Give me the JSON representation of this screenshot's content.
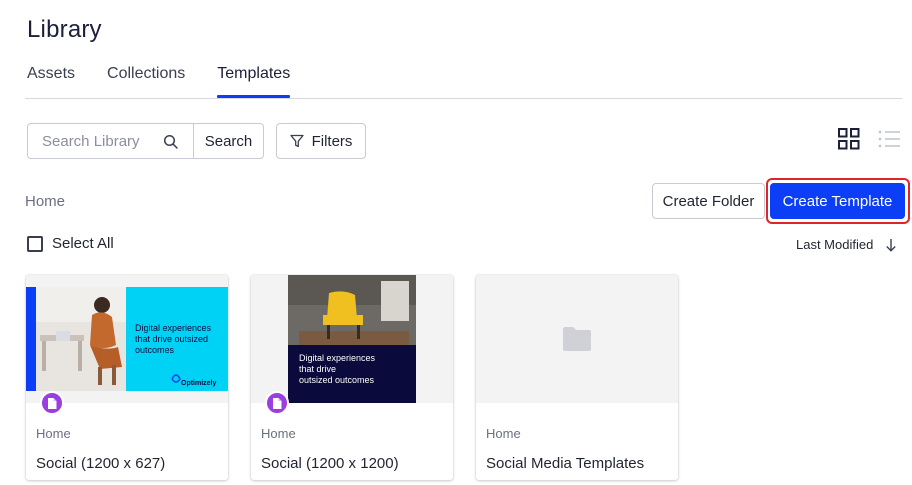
{
  "page": {
    "title": "Library"
  },
  "tabs": [
    {
      "label": "Assets"
    },
    {
      "label": "Collections"
    },
    {
      "label": "Templates",
      "active": true
    }
  ],
  "toolbar": {
    "search_placeholder": "Search Library",
    "search_value": "",
    "search_label": "Search",
    "filters_label": "Filters",
    "view_mode": "grid"
  },
  "breadcrumb": {
    "current": "Home"
  },
  "actions": {
    "create_folder_label": "Create Folder",
    "create_template_label": "Create Template"
  },
  "select_all": {
    "label": "Select All",
    "checked": false
  },
  "sort": {
    "label": "Last Modified",
    "direction": "descending"
  },
  "cards": [
    {
      "type": "template",
      "thumb_text": "Digital experiences\nthat drive outsized\noutcomes",
      "brand_text": "Optimizely",
      "folder": "Home",
      "name": "Social (1200 x 627)"
    },
    {
      "type": "template",
      "thumb_text": "Digital experiences\nthat drive\noutsized outcomes",
      "folder": "Home",
      "name": "Social (1200 x 1200)"
    },
    {
      "type": "folder",
      "folder": "Home",
      "name": "Social Media Templates"
    }
  ],
  "colors": {
    "accent": "#0b3ef5",
    "highlight_border": "#e0242c",
    "template_badge": "#9b3ee0",
    "thumb_cyan": "#00d2f5",
    "thumb_navy": "#0a0a3c"
  }
}
